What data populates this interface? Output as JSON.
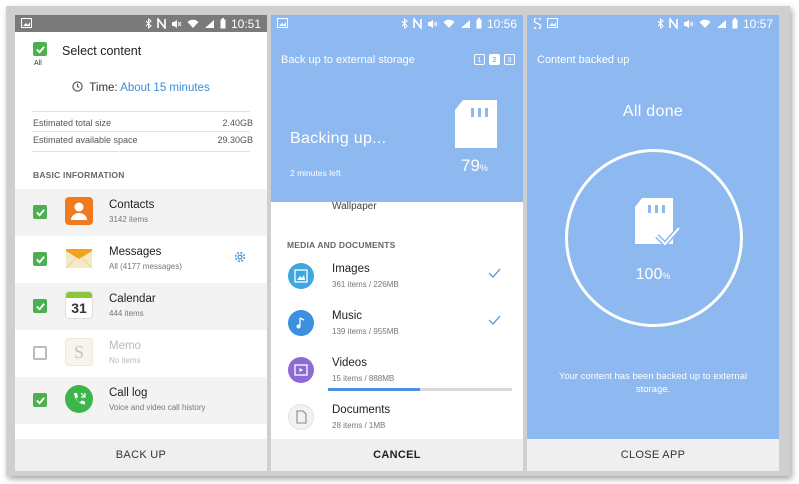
{
  "panel1": {
    "status": {
      "time": "10:51"
    },
    "select_all_label": "All",
    "title": "Select content",
    "time_label": "Time:",
    "time_value": "About 15 minutes",
    "total_size_label": "Estimated total size",
    "total_size_value": "2.40GB",
    "available_label": "Estimated available space",
    "available_value": "29.30GB",
    "section": "BASIC INFORMATION",
    "items": [
      {
        "name": "Contacts",
        "sub": "3142 items",
        "checked": true
      },
      {
        "name": "Messages",
        "sub": "All (4177 messages)",
        "checked": true
      },
      {
        "name": "Calendar",
        "sub": "444 items",
        "checked": true,
        "icon_text": "31"
      },
      {
        "name": "Memo",
        "sub": "No items",
        "checked": false,
        "icon_text": "S"
      },
      {
        "name": "Call log",
        "sub": "Voice and video call history",
        "checked": true
      }
    ],
    "button": "BACK UP"
  },
  "panel2": {
    "status": {
      "time": "10:56"
    },
    "title": "Back up to external storage",
    "steps": [
      "1",
      "2",
      "3"
    ],
    "backing_text": "Backing up...",
    "time_left": "2 minutes left",
    "percent": "79",
    "percent_sign": "%",
    "partial_item": "Wallpaper",
    "section": "MEDIA AND DOCUMENTS",
    "items": [
      {
        "name": "Images",
        "sub": "361 items / 226MB",
        "done": true
      },
      {
        "name": "Music",
        "sub": "139 items / 955MB",
        "done": true
      },
      {
        "name": "Videos",
        "sub": "15 items / 888MB",
        "done": false,
        "progress": 0.5
      },
      {
        "name": "Documents",
        "sub": "28 items / 1MB",
        "done": false
      }
    ],
    "button": "CANCEL"
  },
  "panel3": {
    "status": {
      "time": "10:57"
    },
    "title": "Content backed up",
    "done_text": "All done",
    "percent": "100",
    "percent_sign": "%",
    "message": "Your content has been backed up to external storage.",
    "button": "CLOSE APP"
  },
  "colors": {
    "accent_blue": "#8db8f0",
    "check_green": "#4caf50",
    "link_blue": "#3a8fd6"
  }
}
